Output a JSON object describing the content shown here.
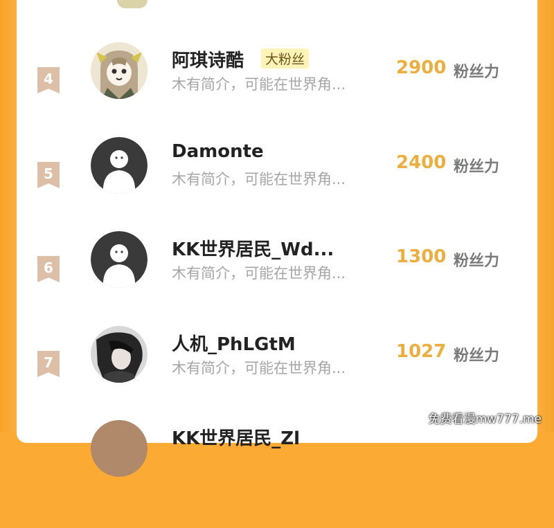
{
  "colors": {
    "frame": "#fbab33",
    "count": "#eeae3e",
    "rank_bg": "#ddbfa8",
    "badge_bg": "#fff3b8"
  },
  "entries": [
    {
      "rank": "4",
      "name": "阿琪诗酷",
      "badge": "大粉丝",
      "bio": "木有简介，可能在世界角...",
      "count": "2900",
      "unit": "粉丝力",
      "avatar": "anime-girl-avatar"
    },
    {
      "rank": "5",
      "name": "Damonte",
      "bio": "木有简介，可能在世界角...",
      "count": "2400",
      "unit": "粉丝力",
      "avatar": "default-avatar"
    },
    {
      "rank": "6",
      "name": "KK世界居民_Wd...",
      "bio": "木有简介，可能在世界角...",
      "count": "1300",
      "unit": "粉丝力",
      "avatar": "default-avatar"
    },
    {
      "rank": "7",
      "name": "人机_PhLGtM",
      "bio": "木有简介，可能在世界角...",
      "count": "1027",
      "unit": "粉丝力",
      "avatar": "dark-character-avatar"
    },
    {
      "name": "KK世界居民_Zl"
    }
  ],
  "watermark": "免费看漫mw777.me"
}
